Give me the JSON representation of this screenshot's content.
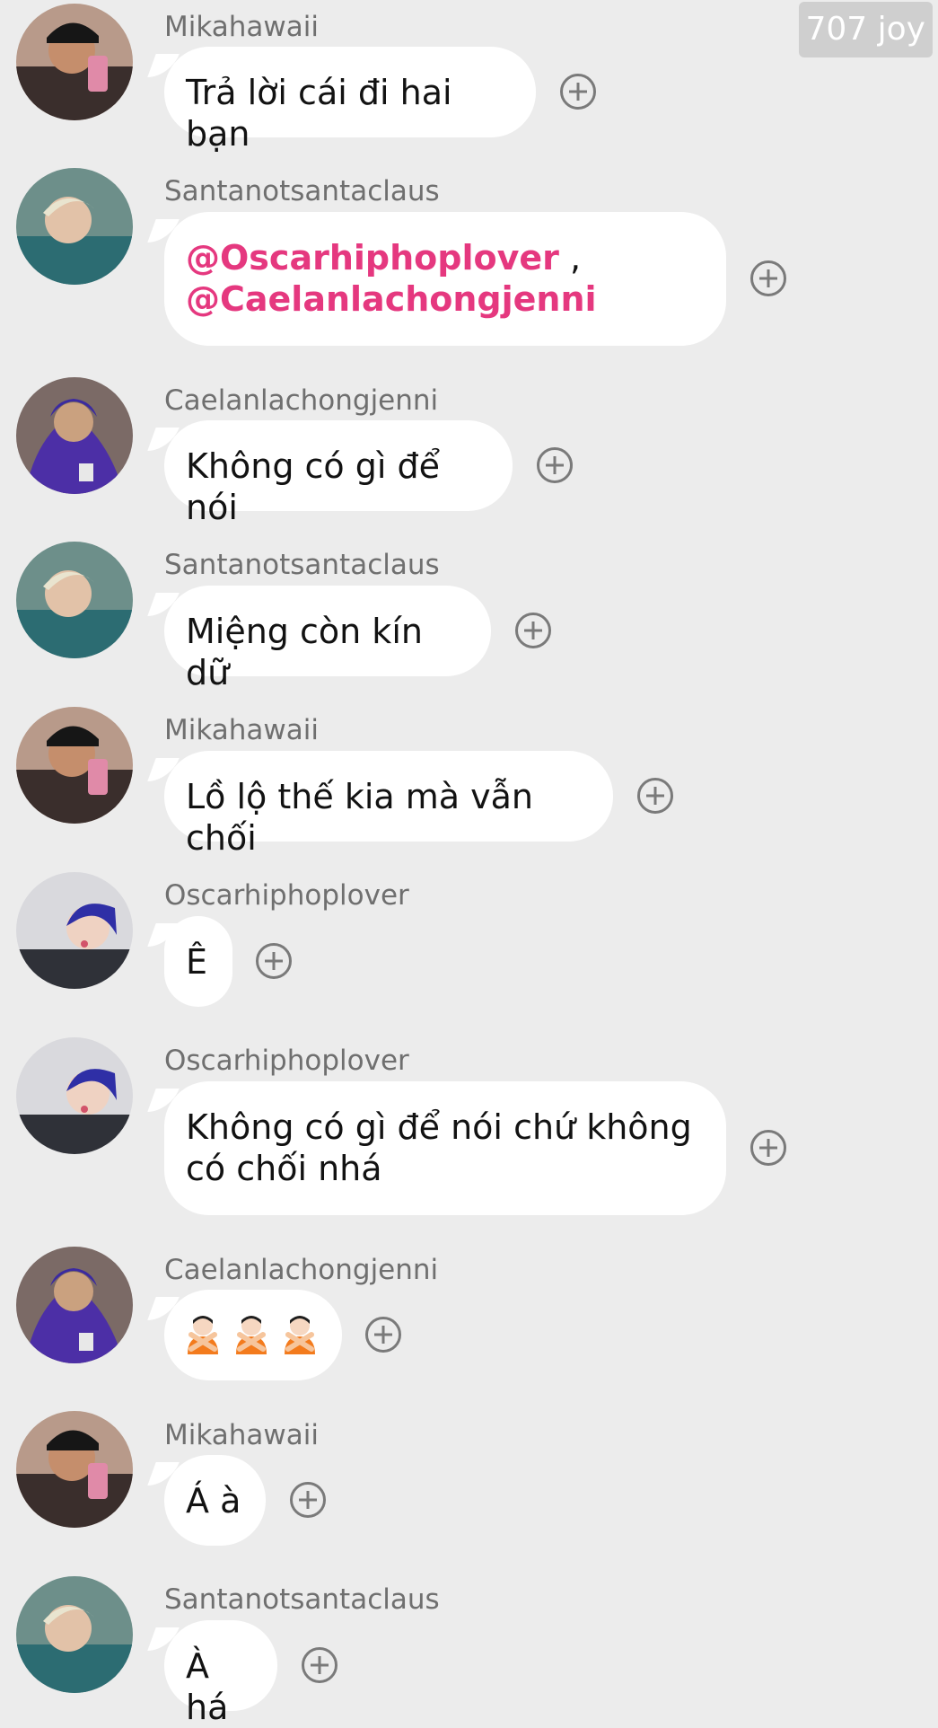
{
  "watermark": "707 joy",
  "messages": [
    {
      "user": "Mikahawaii",
      "avatar": "avatar-mikahawaii",
      "text": "Trả lời cái đi hai bạn"
    },
    {
      "user": "Santanotsantaclaus",
      "avatar": "avatar-santanotsantaclaus",
      "mention1": "@Oscarhiphoplover",
      "sep": " ,",
      "mention2": "@Caelanlachongjenni"
    },
    {
      "user": "Caelanlachongjenni",
      "avatar": "avatar-caelanlachongjenni",
      "text": "Không có gì để nói"
    },
    {
      "user": "Santanotsantaclaus",
      "avatar": "avatar-santanotsantaclaus",
      "text": "Miệng còn kín dữ"
    },
    {
      "user": "Mikahawaii",
      "avatar": "avatar-mikahawaii",
      "text": "Lồ lộ thế kia mà vẫn chối"
    },
    {
      "user": "Oscarhiphoplover",
      "avatar": "avatar-oscarhiphoplover",
      "text": "Ê"
    },
    {
      "user": "Oscarhiphoplover",
      "avatar": "avatar-oscarhiphoplover",
      "line1": "Không có gì để nói chứ không",
      "line2": "có chối nhá"
    },
    {
      "user": "Caelanlachongjenni",
      "avatar": "avatar-caelanlachongjenni",
      "emoji": "person-gesturing-no-emoji"
    },
    {
      "user": "Mikahawaii",
      "avatar": "avatar-mikahawaii",
      "text": "Á à"
    },
    {
      "user": "Santanotsantaclaus",
      "avatar": "avatar-santanotsantaclaus",
      "text": "À há"
    }
  ],
  "react_icon": "add-reaction-icon"
}
